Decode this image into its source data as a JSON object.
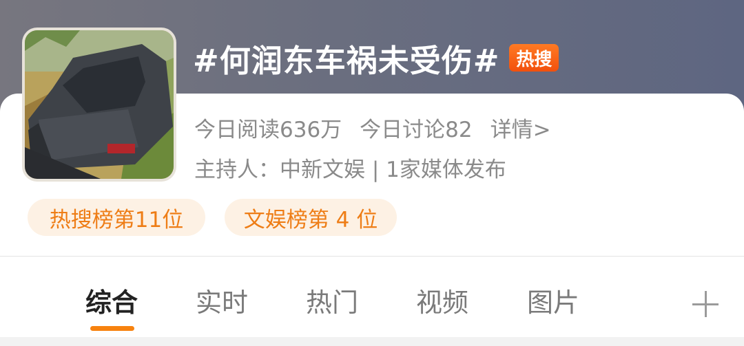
{
  "topic": {
    "title": "#何润东车祸未受伤#",
    "badge": "热搜"
  },
  "stats": {
    "reads": "今日阅读636万",
    "discussions": "今日讨论82",
    "details": "详情>"
  },
  "host": "主持人：中新文娱 | 1家媒体发布",
  "rankings": [
    {
      "label": "热搜榜第11位"
    },
    {
      "label": "文娱榜第 4 位"
    }
  ],
  "tabs": [
    {
      "label": "综合",
      "active": true
    },
    {
      "label": "实时"
    },
    {
      "label": "热门"
    },
    {
      "label": "视频"
    },
    {
      "label": "图片"
    }
  ],
  "icons": {
    "thumbnail": "crashed-car-photo",
    "add": "plus-icon"
  },
  "colors": {
    "accent": "#f7820f",
    "badge": "#f2500d",
    "rank_text": "#ee7d16",
    "rank_bg": "#fdf1e4"
  }
}
